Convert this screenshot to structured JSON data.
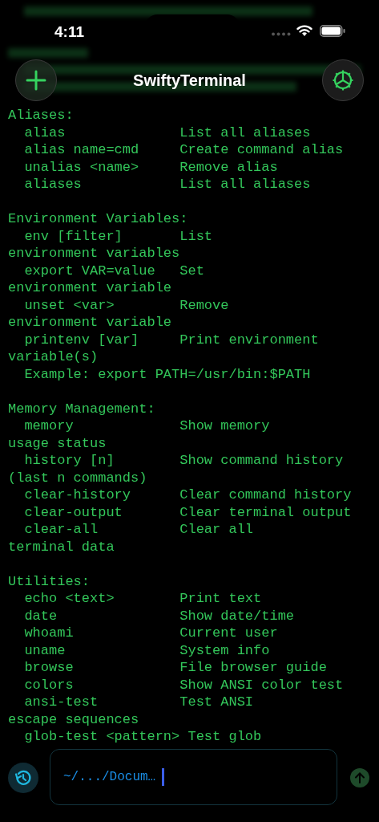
{
  "status_bar": {
    "time": "4:11"
  },
  "header": {
    "title": "SwiftyTerminal"
  },
  "terminal": {
    "blocks": [
      [
        "Aliases:",
        "  alias              List all aliases",
        "  alias name=cmd     Create command alias",
        "  unalias <name>     Remove alias",
        "  aliases            List all aliases"
      ],
      [
        "Environment Variables:",
        "  env [filter]       List",
        "environment variables",
        "  export VAR=value   Set",
        "environment variable",
        "  unset <var>        Remove",
        "environment variable",
        "  printenv [var]     Print environment",
        "variable(s)",
        "  Example: export PATH=/usr/bin:$PATH"
      ],
      [
        "Memory Management:",
        "  memory             Show memory",
        "usage status",
        "  history [n]        Show command history",
        "(last n commands)",
        "  clear-history      Clear command history",
        "  clear-output       Clear terminal output",
        "  clear-all          Clear all",
        "terminal data"
      ],
      [
        "Utilities:",
        "  echo <text>        Print text",
        "  date               Show date/time",
        "  whoami             Current user",
        "  uname              System info",
        "  browse             File browser guide",
        "  colors             Show ANSI color test",
        "  ansi-test          Test ANSI",
        "escape sequences",
        "  glob-test <pattern> Test glob"
      ]
    ]
  },
  "input": {
    "prompt": "~/.../Docum…",
    "send_enabled": false
  }
}
